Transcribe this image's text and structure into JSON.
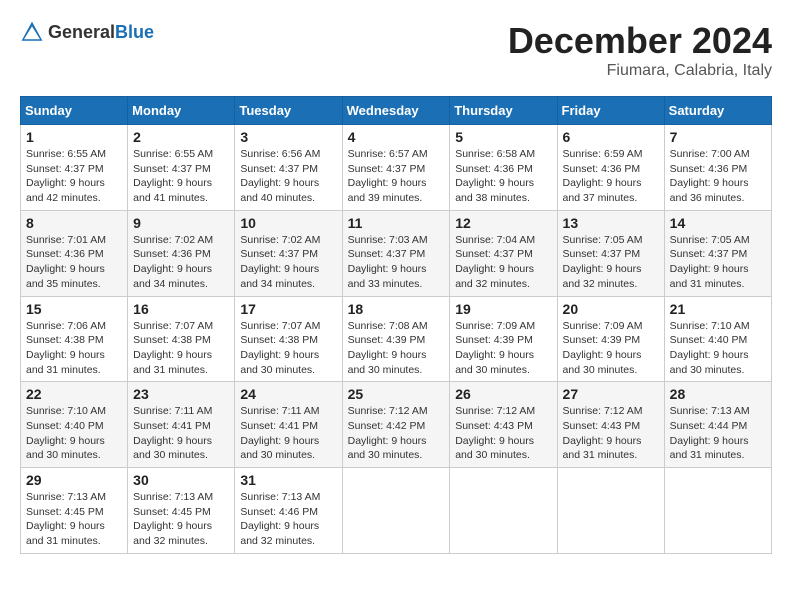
{
  "header": {
    "logo_general": "General",
    "logo_blue": "Blue",
    "month": "December 2024",
    "location": "Fiumara, Calabria, Italy"
  },
  "weekdays": [
    "Sunday",
    "Monday",
    "Tuesday",
    "Wednesday",
    "Thursday",
    "Friday",
    "Saturday"
  ],
  "weeks": [
    [
      {
        "day": "1",
        "sunrise": "6:55 AM",
        "sunset": "4:37 PM",
        "daylight": "9 hours and 42 minutes."
      },
      {
        "day": "2",
        "sunrise": "6:55 AM",
        "sunset": "4:37 PM",
        "daylight": "9 hours and 41 minutes."
      },
      {
        "day": "3",
        "sunrise": "6:56 AM",
        "sunset": "4:37 PM",
        "daylight": "9 hours and 40 minutes."
      },
      {
        "day": "4",
        "sunrise": "6:57 AM",
        "sunset": "4:37 PM",
        "daylight": "9 hours and 39 minutes."
      },
      {
        "day": "5",
        "sunrise": "6:58 AM",
        "sunset": "4:36 PM",
        "daylight": "9 hours and 38 minutes."
      },
      {
        "day": "6",
        "sunrise": "6:59 AM",
        "sunset": "4:36 PM",
        "daylight": "9 hours and 37 minutes."
      },
      {
        "day": "7",
        "sunrise": "7:00 AM",
        "sunset": "4:36 PM",
        "daylight": "9 hours and 36 minutes."
      }
    ],
    [
      {
        "day": "8",
        "sunrise": "7:01 AM",
        "sunset": "4:36 PM",
        "daylight": "9 hours and 35 minutes."
      },
      {
        "day": "9",
        "sunrise": "7:02 AM",
        "sunset": "4:36 PM",
        "daylight": "9 hours and 34 minutes."
      },
      {
        "day": "10",
        "sunrise": "7:02 AM",
        "sunset": "4:37 PM",
        "daylight": "9 hours and 34 minutes."
      },
      {
        "day": "11",
        "sunrise": "7:03 AM",
        "sunset": "4:37 PM",
        "daylight": "9 hours and 33 minutes."
      },
      {
        "day": "12",
        "sunrise": "7:04 AM",
        "sunset": "4:37 PM",
        "daylight": "9 hours and 32 minutes."
      },
      {
        "day": "13",
        "sunrise": "7:05 AM",
        "sunset": "4:37 PM",
        "daylight": "9 hours and 32 minutes."
      },
      {
        "day": "14",
        "sunrise": "7:05 AM",
        "sunset": "4:37 PM",
        "daylight": "9 hours and 31 minutes."
      }
    ],
    [
      {
        "day": "15",
        "sunrise": "7:06 AM",
        "sunset": "4:38 PM",
        "daylight": "9 hours and 31 minutes."
      },
      {
        "day": "16",
        "sunrise": "7:07 AM",
        "sunset": "4:38 PM",
        "daylight": "9 hours and 31 minutes."
      },
      {
        "day": "17",
        "sunrise": "7:07 AM",
        "sunset": "4:38 PM",
        "daylight": "9 hours and 30 minutes."
      },
      {
        "day": "18",
        "sunrise": "7:08 AM",
        "sunset": "4:39 PM",
        "daylight": "9 hours and 30 minutes."
      },
      {
        "day": "19",
        "sunrise": "7:09 AM",
        "sunset": "4:39 PM",
        "daylight": "9 hours and 30 minutes."
      },
      {
        "day": "20",
        "sunrise": "7:09 AM",
        "sunset": "4:39 PM",
        "daylight": "9 hours and 30 minutes."
      },
      {
        "day": "21",
        "sunrise": "7:10 AM",
        "sunset": "4:40 PM",
        "daylight": "9 hours and 30 minutes."
      }
    ],
    [
      {
        "day": "22",
        "sunrise": "7:10 AM",
        "sunset": "4:40 PM",
        "daylight": "9 hours and 30 minutes."
      },
      {
        "day": "23",
        "sunrise": "7:11 AM",
        "sunset": "4:41 PM",
        "daylight": "9 hours and 30 minutes."
      },
      {
        "day": "24",
        "sunrise": "7:11 AM",
        "sunset": "4:41 PM",
        "daylight": "9 hours and 30 minutes."
      },
      {
        "day": "25",
        "sunrise": "7:12 AM",
        "sunset": "4:42 PM",
        "daylight": "9 hours and 30 minutes."
      },
      {
        "day": "26",
        "sunrise": "7:12 AM",
        "sunset": "4:43 PM",
        "daylight": "9 hours and 30 minutes."
      },
      {
        "day": "27",
        "sunrise": "7:12 AM",
        "sunset": "4:43 PM",
        "daylight": "9 hours and 31 minutes."
      },
      {
        "day": "28",
        "sunrise": "7:13 AM",
        "sunset": "4:44 PM",
        "daylight": "9 hours and 31 minutes."
      }
    ],
    [
      {
        "day": "29",
        "sunrise": "7:13 AM",
        "sunset": "4:45 PM",
        "daylight": "9 hours and 31 minutes."
      },
      {
        "day": "30",
        "sunrise": "7:13 AM",
        "sunset": "4:45 PM",
        "daylight": "9 hours and 32 minutes."
      },
      {
        "day": "31",
        "sunrise": "7:13 AM",
        "sunset": "4:46 PM",
        "daylight": "9 hours and 32 minutes."
      },
      null,
      null,
      null,
      null
    ]
  ]
}
